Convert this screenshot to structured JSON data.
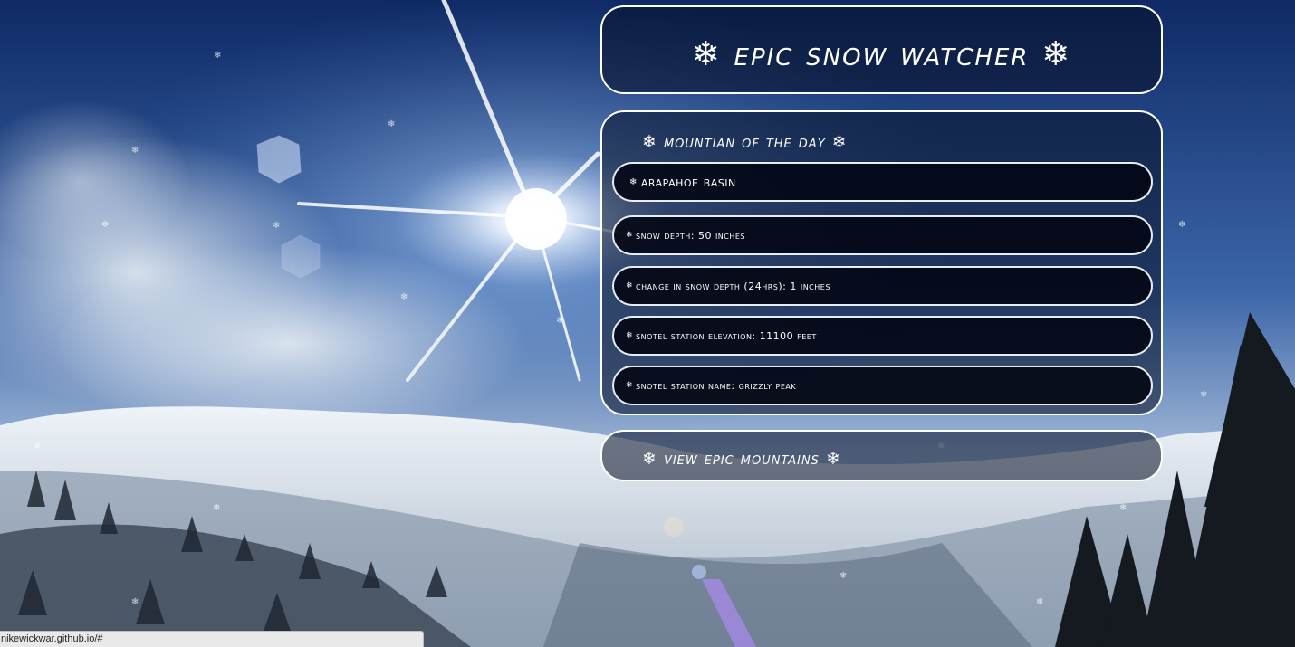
{
  "app": {
    "title": "❄ Epic Snow Watcher ❄"
  },
  "mountain_of_day": {
    "heading": "❄ Mountian of the Day ❄",
    "name": "Arapahoe Basin",
    "details": [
      "Snow Depth: 50 inches",
      "Change in Snow Depth (24hrs): 1 inches",
      "Snotel Station Elevation: 11100 feet",
      "Snotel Station Name: GRIZZLY PEAK"
    ]
  },
  "nav": {
    "view_mountains_label": "❄ View Epic Mountains ❄"
  },
  "browser_status": {
    "url": "nikewickwar.github.io/#"
  },
  "icons": {
    "bullet": "snowflake-icon"
  },
  "colors": {
    "panel_border": "#ffffff",
    "panel_fill": "#081026",
    "row_fill": "#020612",
    "sky": "#2b4a80"
  }
}
